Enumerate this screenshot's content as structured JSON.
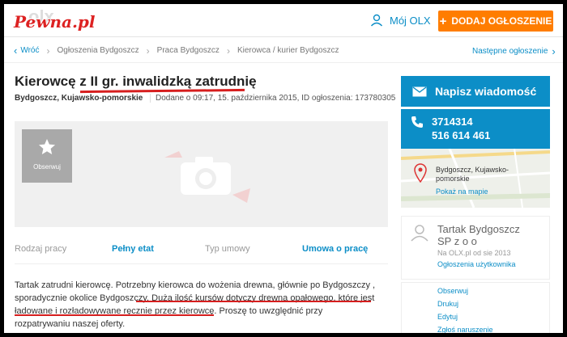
{
  "header": {
    "watermark": "Pewna.pl",
    "olx_logo": "olx",
    "my_olx": "Mój OLX",
    "add_ad": "DODAJ OGŁOSZENIE"
  },
  "breadcrumb": {
    "back": "Wróć",
    "items": [
      "Ogłoszenia Bydgoszcz",
      "Praca Bydgoszcz",
      "Kierowca / kurier Bydgoszcz"
    ],
    "next": "Następne ogłoszenie"
  },
  "listing": {
    "title": "Kierowcę z II gr. inwalidzką zatrudnię",
    "location": "Bydgoszcz, Kujawsko-pomorskie",
    "meta": "Dodane o 09:17, 15. października 2015, ID ogłoszenia: 173780305",
    "follow": "Obserwuj",
    "params": [
      {
        "label": "Rodzaj pracy",
        "value": "Pełny etat"
      },
      {
        "label": "Typ umowy",
        "value": "Umowa o pracę"
      }
    ],
    "description": "Tartak zatrudni kierowcę. Potrzebny kierowca do wożenia drewna, głównie po Bydgoszczy , sporadycznie okolice Bydgoszczy. Duża ilość kursów dotyczy drewna opałowego, które jest ładowane i rozładowywane ręcznie przez kierowcę. Proszę to uwzględnić przy rozpatrywaniu naszej oferty."
  },
  "sidebar": {
    "message_button": "Napisz wiadomość",
    "phone1": "3714314",
    "phone2": "516 614 461",
    "map_location_line1": "Bydgoszcz, Kujawsko-",
    "map_location_line2": "pomorskie",
    "map_link": "Pokaż na mapie",
    "seller_name": "Tartak Bydgoszcz SP z o o",
    "seller_since": "Na OLX.pl od sie 2013",
    "seller_ads": "Ogłoszenia użytkownika",
    "actions": [
      "Obserwuj",
      "Drukuj",
      "Edytuj",
      "Zgłoś naruszenie"
    ]
  },
  "colors": {
    "accent": "#0c8ec7",
    "orange": "#ff7d00",
    "annotation": "#d61e1e"
  }
}
